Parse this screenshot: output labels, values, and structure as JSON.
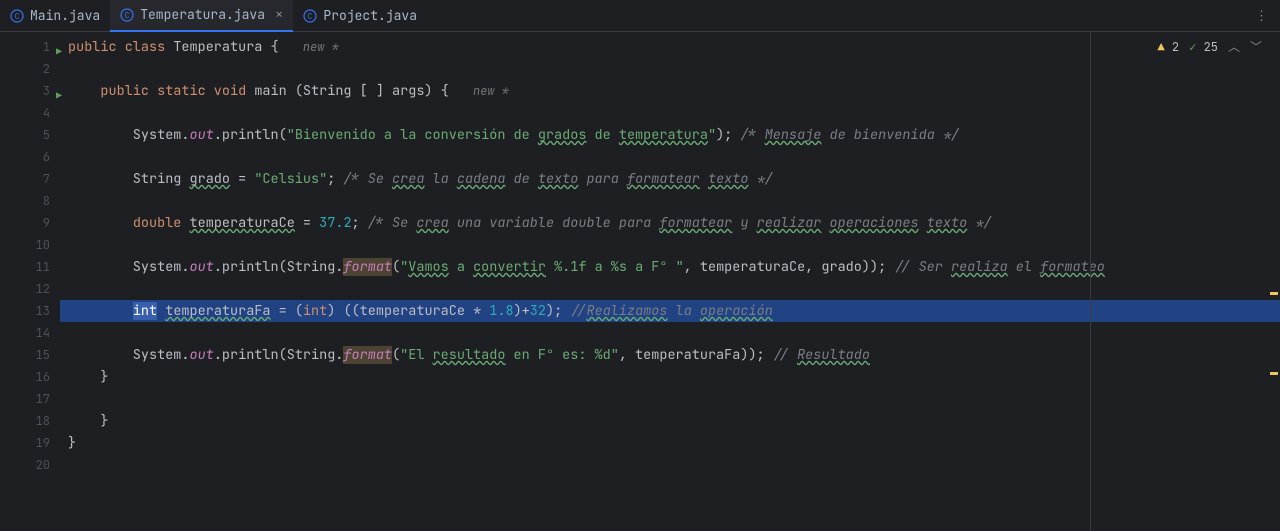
{
  "tabs": [
    {
      "label": "Main.java",
      "active": false
    },
    {
      "label": "Temperatura.java",
      "active": true
    },
    {
      "label": "Project.java",
      "active": false
    }
  ],
  "inspections": {
    "warn_count": "2",
    "ok_count": "25"
  },
  "gutter": {
    "run_lines": [
      1,
      3
    ]
  },
  "highlighted_line": 13,
  "code_plain": [
    "public class Temperatura {   new *",
    "",
    "    public static void main (String [ ] args) {   new *",
    "",
    "        System.out.println(\"Bienvenido a la conversión de grados de temperatura\"); /* Mensaje de bienvenida */",
    "",
    "        String grado = \"Celsius\"; /* Se crea la cadena de texto para formatear texto */",
    "",
    "        double temperaturaCe = 37.2; /* Se crea una variable double para formatear y realizar operaciones texto */",
    "",
    "        System.out.println(String.format(\"Vamos a convertir %.1f a %s a F° \", temperaturaCe, grado)); // Ser realiza el formateo",
    "",
    "        int temperaturaFa = (int) ((temperaturaCe * 1.8)+32); //Realizamos la operación",
    "",
    "        System.out.println(String.format(\"El resultado en F° es: %d\", temperaturaFa)); // Resultado",
    "    }",
    "",
    "    }",
    "}",
    ""
  ],
  "code": [
    [
      {
        "t": "public class ",
        "c": "kw"
      },
      {
        "t": "Temperatura",
        "c": "cls"
      },
      {
        "t": " {   ",
        "c": ""
      },
      {
        "t": "new *",
        "c": "hint"
      }
    ],
    [],
    [
      {
        "t": "    ",
        "c": ""
      },
      {
        "t": "public static void ",
        "c": "kw"
      },
      {
        "t": "main",
        "c": "mth"
      },
      {
        "t": " (String [ ] args) {   ",
        "c": ""
      },
      {
        "t": "new *",
        "c": "hint"
      }
    ],
    [],
    [
      {
        "t": "        System.",
        "c": ""
      },
      {
        "t": "out",
        "c": "fld"
      },
      {
        "t": ".println(",
        "c": ""
      },
      {
        "t": "\"Bienvenido a la conversión de ",
        "c": "str"
      },
      {
        "t": "grados",
        "c": "str typo"
      },
      {
        "t": " de ",
        "c": "str"
      },
      {
        "t": "temperatura",
        "c": "str typo"
      },
      {
        "t": "\"",
        "c": "str"
      },
      {
        "t": "); ",
        "c": ""
      },
      {
        "t": "/* ",
        "c": "com"
      },
      {
        "t": "Mensaje",
        "c": "com typo"
      },
      {
        "t": " de bienvenida */",
        "c": "com"
      }
    ],
    [],
    [
      {
        "t": "        String ",
        "c": ""
      },
      {
        "t": "grado",
        "c": "typo"
      },
      {
        "t": " = ",
        "c": ""
      },
      {
        "t": "\"Celsius\"",
        "c": "str"
      },
      {
        "t": "; ",
        "c": ""
      },
      {
        "t": "/* Se ",
        "c": "com"
      },
      {
        "t": "crea",
        "c": "com typo"
      },
      {
        "t": " la ",
        "c": "com"
      },
      {
        "t": "cadena",
        "c": "com typo"
      },
      {
        "t": " de ",
        "c": "com"
      },
      {
        "t": "texto",
        "c": "com typo"
      },
      {
        "t": " para ",
        "c": "com"
      },
      {
        "t": "formatear",
        "c": "com typo"
      },
      {
        "t": " ",
        "c": "com"
      },
      {
        "t": "texto",
        "c": "com typo"
      },
      {
        "t": " */",
        "c": "com"
      }
    ],
    [],
    [
      {
        "t": "        ",
        "c": ""
      },
      {
        "t": "double ",
        "c": "kw"
      },
      {
        "t": "temperaturaCe",
        "c": "typo"
      },
      {
        "t": " = ",
        "c": ""
      },
      {
        "t": "37.2",
        "c": "num"
      },
      {
        "t": "; ",
        "c": ""
      },
      {
        "t": "/* Se ",
        "c": "com"
      },
      {
        "t": "crea",
        "c": "com typo"
      },
      {
        "t": " una variable double para ",
        "c": "com"
      },
      {
        "t": "formatear",
        "c": "com typo"
      },
      {
        "t": " y ",
        "c": "com"
      },
      {
        "t": "realizar",
        "c": "com typo"
      },
      {
        "t": " ",
        "c": "com"
      },
      {
        "t": "operaciones",
        "c": "com typo"
      },
      {
        "t": " ",
        "c": "com"
      },
      {
        "t": "texto",
        "c": "com typo"
      },
      {
        "t": " */",
        "c": "com"
      }
    ],
    [],
    [
      {
        "t": "        System.",
        "c": ""
      },
      {
        "t": "out",
        "c": "fld"
      },
      {
        "t": ".println(String.",
        "c": ""
      },
      {
        "t": "format",
        "c": "fld warnbg"
      },
      {
        "t": "(",
        "c": ""
      },
      {
        "t": "\"",
        "c": "str"
      },
      {
        "t": "Vamos",
        "c": "str typo"
      },
      {
        "t": " a ",
        "c": "str"
      },
      {
        "t": "convertir",
        "c": "str typo"
      },
      {
        "t": " %.1f a %s a F° \"",
        "c": "str"
      },
      {
        "t": ", temperaturaCe, grado)); ",
        "c": ""
      },
      {
        "t": "// Ser ",
        "c": "com"
      },
      {
        "t": "realiza",
        "c": "com typo"
      },
      {
        "t": " el ",
        "c": "com"
      },
      {
        "t": "formateo",
        "c": "com typo"
      }
    ],
    [],
    [
      {
        "t": "        ",
        "c": ""
      },
      {
        "t": "int",
        "c": "kw sel"
      },
      {
        "t": " ",
        "c": ""
      },
      {
        "t": "temperaturaFa",
        "c": "typo"
      },
      {
        "t": " = (",
        "c": ""
      },
      {
        "t": "int",
        "c": "kw"
      },
      {
        "t": ") ((temperaturaCe * ",
        "c": ""
      },
      {
        "t": "1.8",
        "c": "num"
      },
      {
        "t": ")+",
        "c": ""
      },
      {
        "t": "32",
        "c": "num"
      },
      {
        "t": "); ",
        "c": ""
      },
      {
        "t": "//",
        "c": "com"
      },
      {
        "t": "Realizamos",
        "c": "com typo"
      },
      {
        "t": " la ",
        "c": "com"
      },
      {
        "t": "operación",
        "c": "com typo"
      }
    ],
    [],
    [
      {
        "t": "        System.",
        "c": ""
      },
      {
        "t": "out",
        "c": "fld"
      },
      {
        "t": ".println(String.",
        "c": ""
      },
      {
        "t": "format",
        "c": "fld warnbg"
      },
      {
        "t": "(",
        "c": ""
      },
      {
        "t": "\"El ",
        "c": "str"
      },
      {
        "t": "resultado",
        "c": "str typo"
      },
      {
        "t": " en F° es: %d\"",
        "c": "str"
      },
      {
        "t": ", temperaturaFa)); ",
        "c": ""
      },
      {
        "t": "// ",
        "c": "com"
      },
      {
        "t": "Resultado",
        "c": "com typo"
      }
    ],
    [
      {
        "t": "    }",
        "c": ""
      }
    ],
    [],
    [
      {
        "t": "    }",
        "c": ""
      }
    ],
    [
      {
        "t": "}",
        "c": ""
      }
    ],
    []
  ]
}
